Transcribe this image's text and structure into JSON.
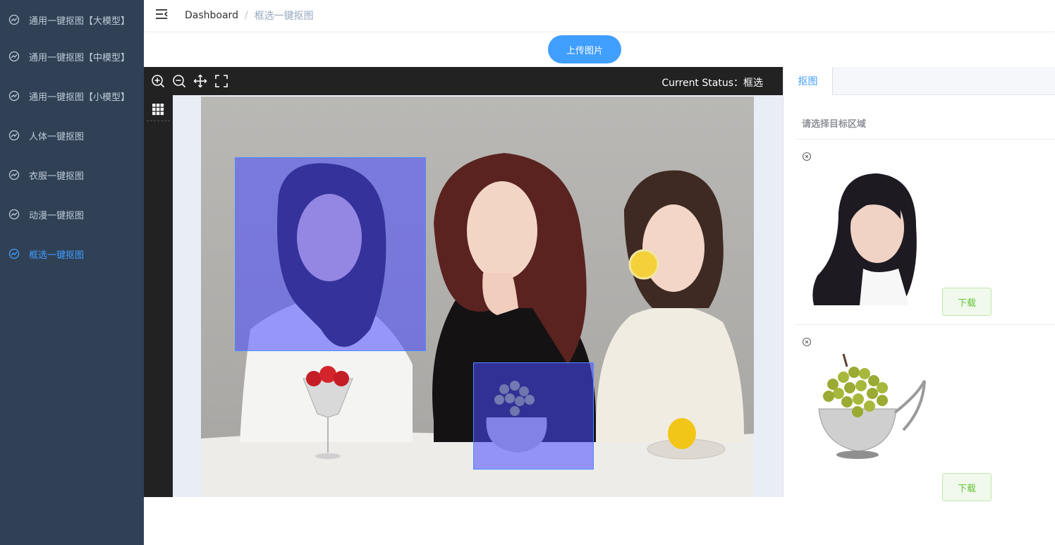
{
  "sidebar": {
    "items": [
      {
        "label": "通用一键抠图【大模型】",
        "icon": "chart-icon",
        "active": false
      },
      {
        "label": "通用一键抠图【中模型】",
        "icon": "chart-icon",
        "active": false
      },
      {
        "label": "通用一键抠图【小模型】",
        "icon": "chart-icon",
        "active": false
      },
      {
        "label": "人体一键抠图",
        "icon": "chart-icon",
        "active": false
      },
      {
        "label": "衣服一键抠图",
        "icon": "chart-icon",
        "active": false
      },
      {
        "label": "动漫一键抠图",
        "icon": "chart-icon",
        "active": false
      },
      {
        "label": "框选一键抠图",
        "icon": "chart-icon",
        "active": true
      }
    ]
  },
  "breadcrumb": {
    "home": "Dashboard",
    "separator": "/",
    "current": "框选一键抠图"
  },
  "upload": {
    "label": "上传图片"
  },
  "editor": {
    "toolbar_icons": [
      "zoom-in-icon",
      "zoom-out-icon",
      "move-icon",
      "fullscreen-icon"
    ],
    "status": "Current Status：框选",
    "side_icon": "grid-icon"
  },
  "panel": {
    "tab": "抠图",
    "hint": "请选择目标区域",
    "results": [
      {
        "download_label": "下载",
        "subject": "portrait-cutout"
      },
      {
        "download_label": "下载",
        "subject": "grapes-cutout"
      }
    ]
  },
  "colors": {
    "sidebar_bg": "#304156",
    "sidebar_text": "#bfcbd9",
    "active": "#409eff",
    "selection": "#4848ff",
    "download_text": "#67c23a"
  }
}
